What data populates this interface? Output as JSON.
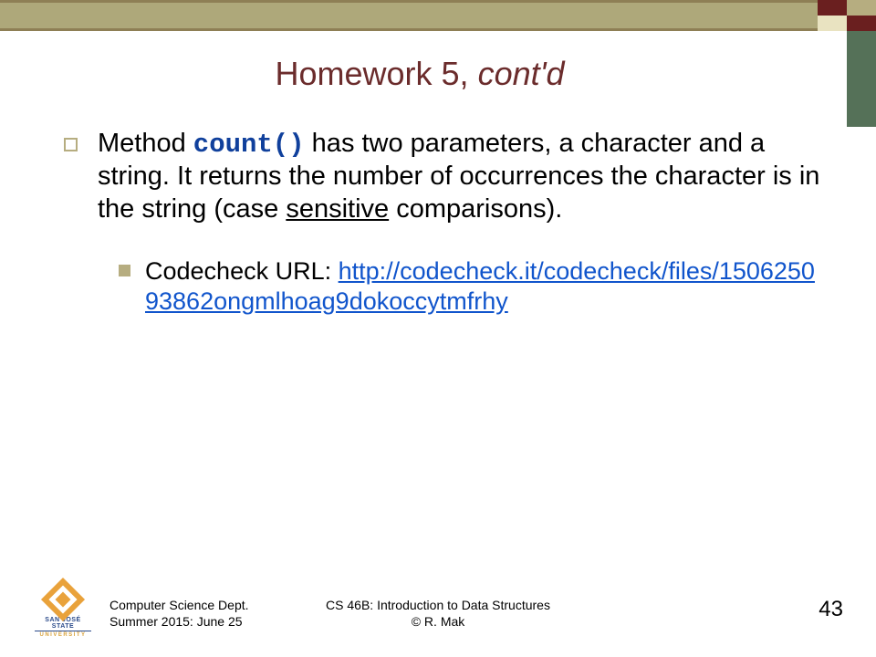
{
  "slide": {
    "title_main": "Homework 5",
    "title_sep": ", ",
    "title_contd": "cont'd"
  },
  "bullet1": {
    "pre": "Method ",
    "code": "count()",
    "mid": " has two parameters, a character and a string. It returns the number of occurrences the character is in the string (case ",
    "underlined": "sensitive",
    "post": " comparisons)."
  },
  "bullet2": {
    "label": "Codecheck URL: ",
    "url_text": "http://codecheck.it/codecheck/files/150625093862ongmlhoag9dokoccytmfrhy",
    "url_href": "http://codecheck.it/codecheck/files/150625093862ongmlhoag9dokoccytmfrhy"
  },
  "footer": {
    "logo_line1": "SAN JOSÉ STATE",
    "logo_line2": "UNIVERSITY",
    "left_line1": "Computer Science Dept.",
    "left_line2": "Summer 2015: June 25",
    "center_line1": "CS 46B: Introduction to Data Structures",
    "center_line2": "© R. Mak",
    "page_number": "43"
  }
}
